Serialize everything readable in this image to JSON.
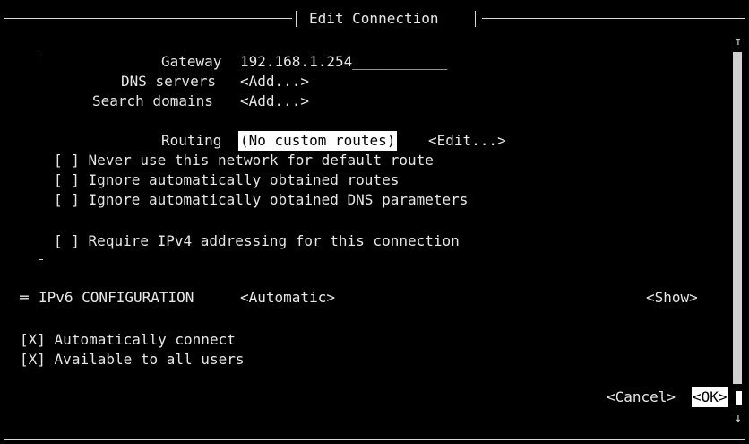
{
  "dialog": {
    "title": "Edit Connection"
  },
  "ipv4": {
    "gateway_label": "Gateway",
    "gateway_value": "192.168.1.254",
    "gateway_fill": "___________",
    "dns_label": "DNS servers",
    "dns_button": "<Add...>",
    "search_label": "Search domains",
    "search_button": "<Add...>",
    "routing_label": "Routing",
    "routing_value": "(No custom routes)",
    "routing_edit": "<Edit...>",
    "never_default": {
      "box": "[ ]",
      "label": "Never use this network for default route"
    },
    "ignore_routes": {
      "box": "[ ]",
      "label": "Ignore automatically obtained routes"
    },
    "ignore_dns": {
      "box": "[ ]",
      "label": "Ignore automatically obtained DNS parameters"
    },
    "require_ipv4": {
      "box": "[ ]",
      "label": "Require IPv4 addressing for this connection"
    }
  },
  "ipv6": {
    "marker": "═",
    "label": "IPv6 CONFIGURATION",
    "mode": "<Automatic>",
    "show": "<Show>"
  },
  "options": {
    "auto_connect": {
      "box": "[X]",
      "label": "Automatically connect"
    },
    "all_users": {
      "box": "[X]",
      "label": "Available to all users"
    }
  },
  "buttons": {
    "cancel": "<Cancel>",
    "ok": "<OK>"
  },
  "scroll": {
    "up_arrow": "↑",
    "down_arrow": "↓"
  },
  "colors": {
    "background": "#000000",
    "text": "#e8e8e8",
    "highlight_bg": "#ffffff",
    "highlight_fg": "#000000"
  }
}
